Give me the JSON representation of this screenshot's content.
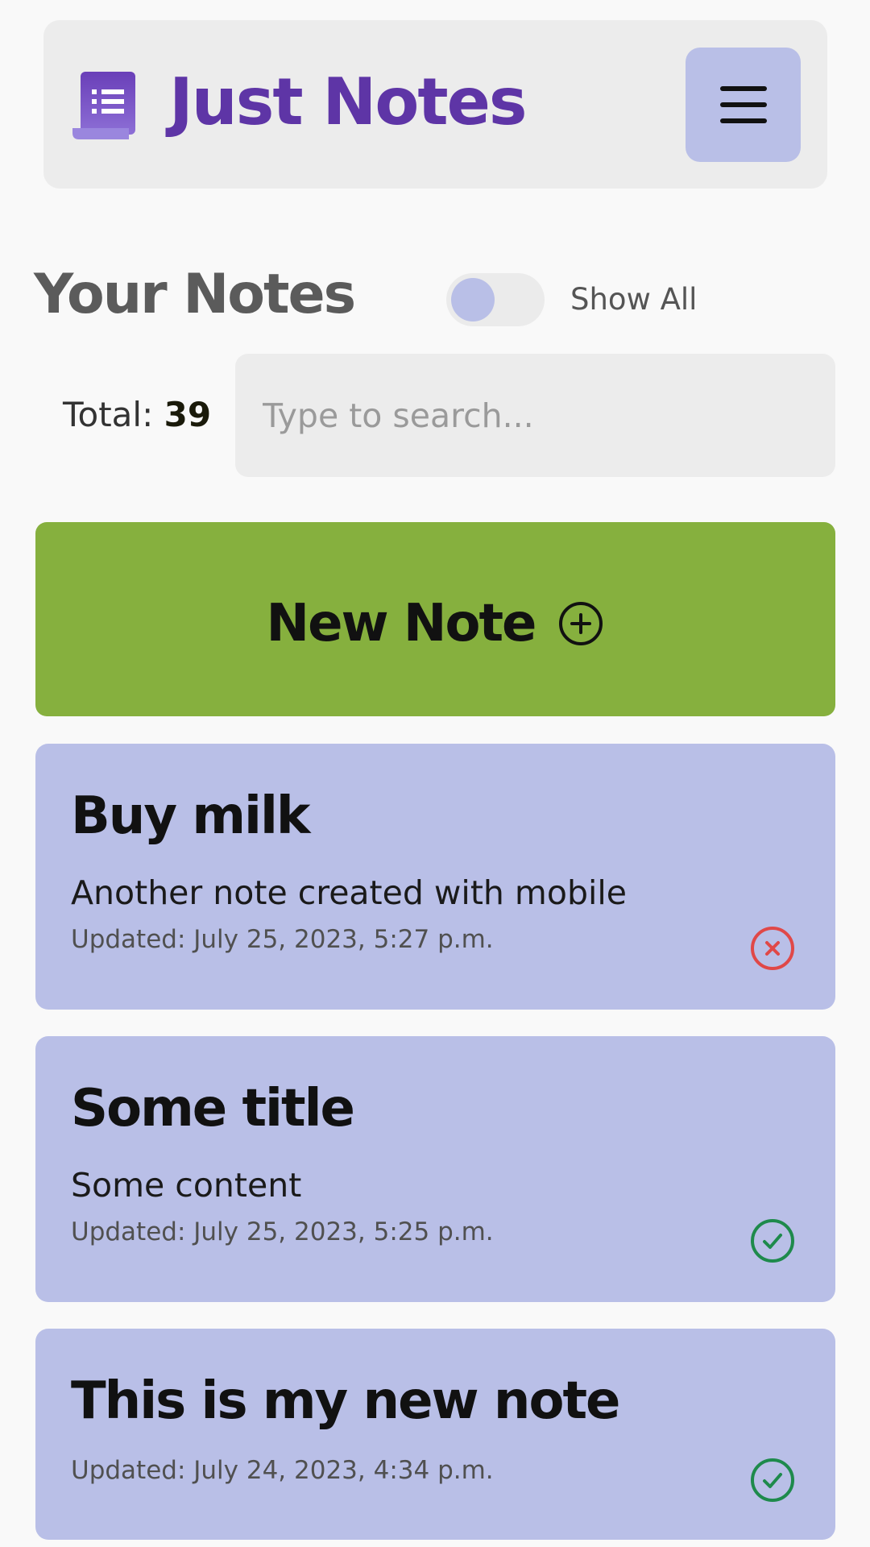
{
  "header": {
    "app_title": "Just Notes",
    "logo_icon": "notes-list-icon",
    "menu_icon": "hamburger-menu-icon",
    "brand_color": "#5e35a6"
  },
  "notes_section": {
    "title": "Your Notes",
    "toggle_label": "Show All",
    "toggle_on": false,
    "total_label": "Total:",
    "total_count": "39",
    "search_placeholder": "Type to search..."
  },
  "new_note_button": {
    "label": "New Note",
    "icon": "plus-circle-icon",
    "color": "#86b03e"
  },
  "notes": [
    {
      "title": "Buy milk",
      "content": "Another note created with mobile",
      "updated": "Updated: July 25, 2023, 5:27 p.m.",
      "status": "incomplete",
      "status_icon": "x-circle-icon",
      "status_color": "#e04848"
    },
    {
      "title": "Some title",
      "content": "Some content",
      "updated": "Updated: July 25, 2023, 5:25 p.m.",
      "status": "complete",
      "status_icon": "check-circle-icon",
      "status_color": "#1e8a4c"
    },
    {
      "title": "This is my new note",
      "content": "",
      "updated": "Updated: July 24, 2023, 4:34 p.m.",
      "status": "complete",
      "status_icon": "check-circle-icon",
      "status_color": "#1e8a4c"
    }
  ],
  "card_color": "#b9bfe7"
}
